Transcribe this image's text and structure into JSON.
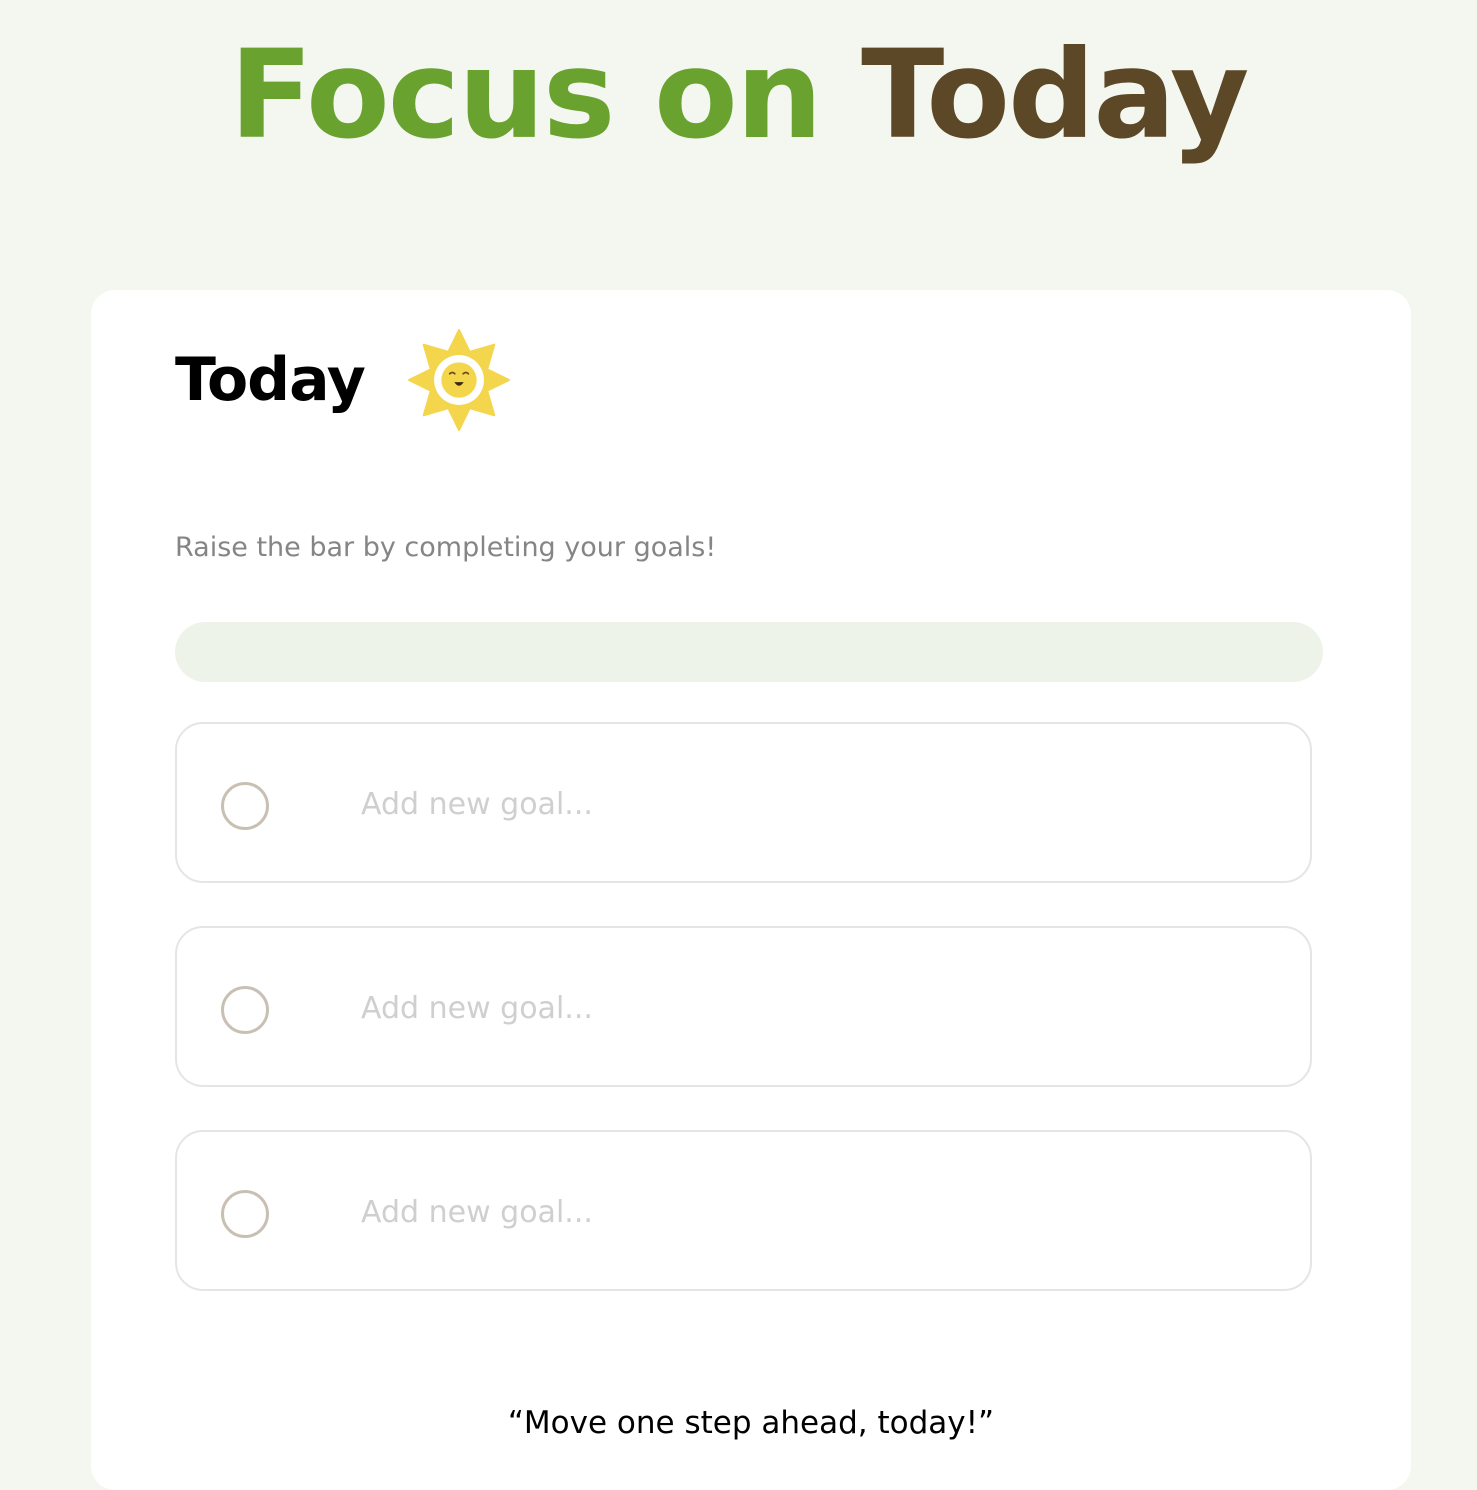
{
  "header": {
    "title_part1": "Focus on",
    "title_part2": "Today"
  },
  "card": {
    "heading": "Today",
    "heading_icon": "smiling-sun-icon",
    "subtitle": "Raise the bar by completing your goals!",
    "progress": {
      "completed": 0,
      "total": 3,
      "fraction": 0
    },
    "goals": [
      {
        "placeholder": "Add new goal...",
        "value": "",
        "completed": false
      },
      {
        "placeholder": "Add new goal...",
        "value": "",
        "completed": false
      },
      {
        "placeholder": "Add new goal...",
        "value": "",
        "completed": false
      }
    ],
    "quote": "“Move one step ahead, today!”"
  },
  "colors": {
    "page_background": "#f4f7f0",
    "accent_green": "#6aa230",
    "accent_brown": "#5c4826",
    "progress_track": "#eef3ea",
    "checkbox_border": "#c9c0b4",
    "sun_yellow": "#f3d64c"
  }
}
